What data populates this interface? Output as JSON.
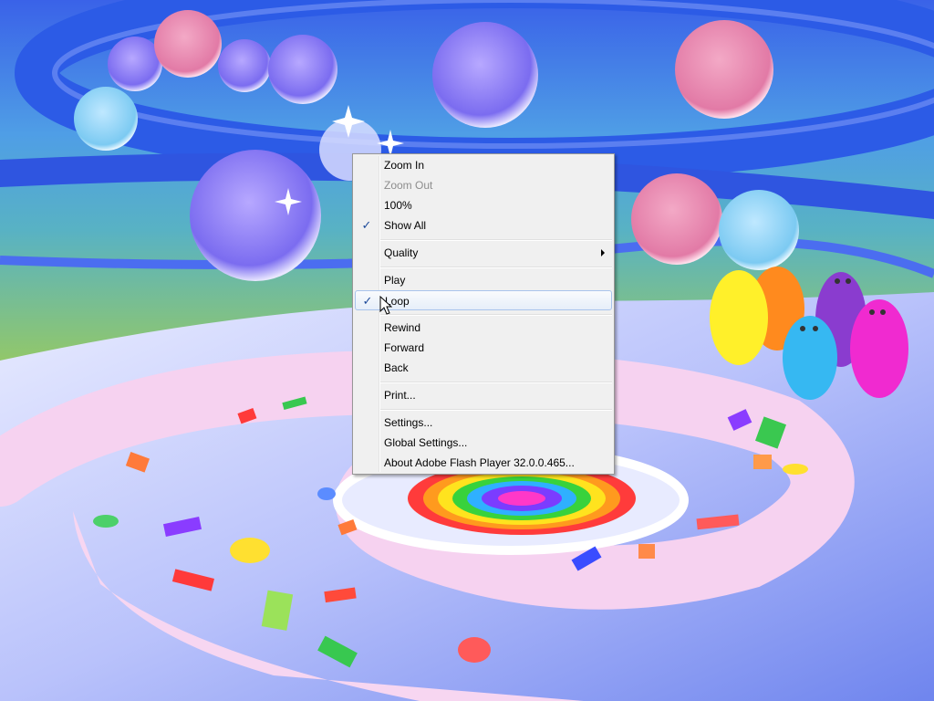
{
  "context_menu": {
    "zoom_in": "Zoom In",
    "zoom_out": "Zoom Out",
    "zoom_100": "100%",
    "show_all": "Show All",
    "quality": "Quality",
    "play": "Play",
    "loop": "Loop",
    "rewind": "Rewind",
    "forward": "Forward",
    "back": "Back",
    "print": "Print...",
    "settings": "Settings...",
    "global_settings": "Global Settings...",
    "about": "About Adobe Flash Player 32.0.0.465...",
    "checked": [
      "Show All",
      "Loop"
    ],
    "disabled": [
      "Zoom Out"
    ],
    "highlighted": "Loop"
  },
  "icons": {
    "check": "check-icon",
    "submenu": "submenu-arrow-icon",
    "cursor": "mouse-cursor-icon"
  },
  "colors": {
    "menu_bg": "#f0f0f0",
    "menu_border": "#979797",
    "highlight_border": "#a8c4ec",
    "check": "#1d4a9a",
    "disabled_text": "#8d8d8d"
  }
}
